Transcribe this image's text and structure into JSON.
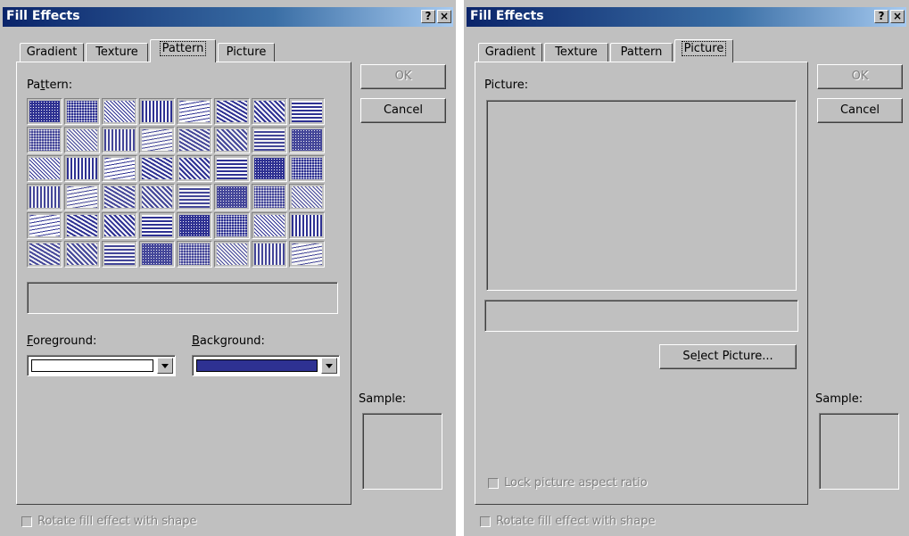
{
  "pattern_dialog": {
    "title": "Fill Effects",
    "help_btn": "?",
    "close_btn": "×",
    "tabs": [
      "Gradient",
      "Texture",
      "Pattern",
      "Picture"
    ],
    "pattern_label_pre": "Pa",
    "pattern_label_key": "t",
    "pattern_label_post": "tern:",
    "foreground_key": "F",
    "foreground_rest": "oreground:",
    "background_key": "B",
    "background_rest": "ackground:",
    "foreground_color": "#ffffff",
    "background_color": "#2e3192",
    "ok": "OK",
    "cancel": "Cancel",
    "sample": "Sample:",
    "rotate": "Rotate fill effect with shape"
  },
  "picture_dialog": {
    "title": "Fill Effects",
    "help_btn": "?",
    "close_btn": "×",
    "tabs": [
      "Gradient",
      "Texture",
      "Pattern",
      "Picture"
    ],
    "picture_label": "Picture:",
    "select_pre": "Se",
    "select_key": "l",
    "select_post": "ect Picture...",
    "lock": "Lock picture aspect ratio",
    "ok": "OK",
    "cancel": "Cancel",
    "sample": "Sample:",
    "rotate": "Rotate fill effect with shape"
  }
}
